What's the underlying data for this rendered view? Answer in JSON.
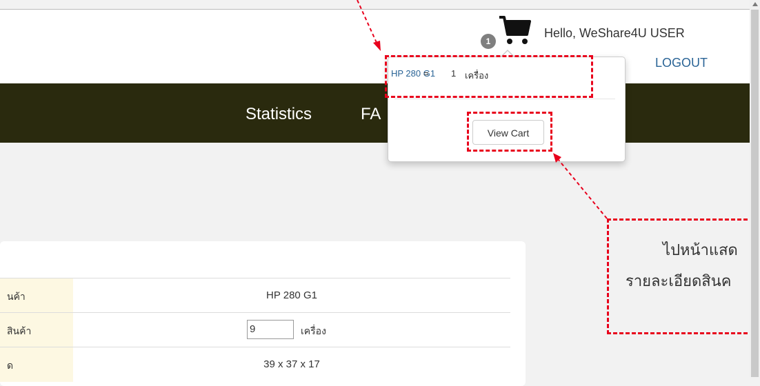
{
  "header": {
    "cart_count": "1",
    "greeting": "Hello, WeShare4U USER",
    "logout_label": "LOGOUT"
  },
  "nav": {
    "items": [
      "Statistics",
      "FA"
    ]
  },
  "cart_popover": {
    "item_name": "HP 280 G1",
    "equals": "=",
    "quantity": "1",
    "unit": "เครื่อง",
    "view_cart_label": "View Cart"
  },
  "product_table": {
    "rows": [
      {
        "label": "นค้า",
        "value": "HP 280 G1"
      },
      {
        "label": "สินค้า",
        "input_value": "9",
        "unit": "เครื่อง"
      },
      {
        "label": "ด",
        "value": "39 x 37 x 17"
      }
    ]
  },
  "annotation": {
    "line1": "ไปหน้าแสด",
    "line2": "รายละเอียดสินค"
  },
  "colors": {
    "navbar": "#2a2a0e",
    "annotation_red": "#e8001c",
    "link_blue": "#2a6496",
    "label_cell": "#fdf8e2"
  }
}
